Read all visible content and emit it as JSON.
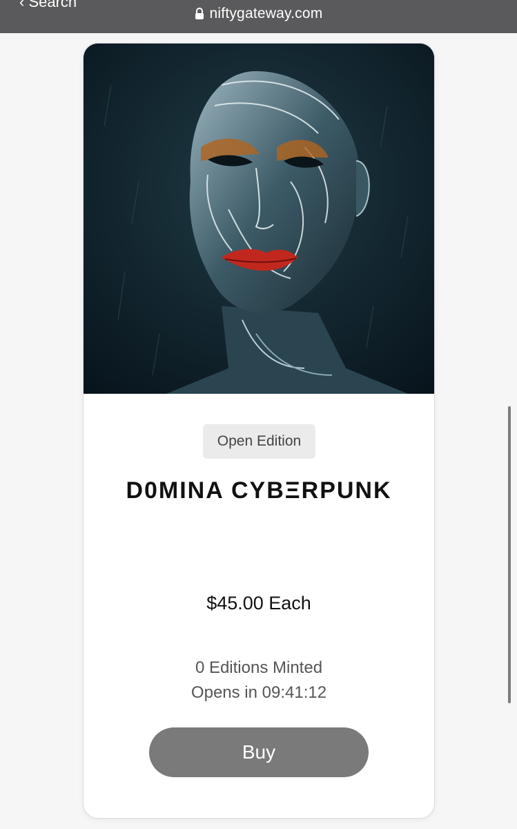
{
  "browser": {
    "back_label": "‹ Search",
    "url": "niftygateway.com",
    "lock_icon": "lock-icon"
  },
  "card": {
    "badge": "Open Edition",
    "title": "D0MINA CYBΞRPUNK",
    "price": "$45.00 Each",
    "editions_minted": "0 Editions Minted",
    "opens_in": "Opens in 09:41:12",
    "buy_label": "Buy"
  },
  "colors": {
    "topbar": "#5a5a5c",
    "buy_button": "#7a7a7a",
    "badge_bg": "#ebebeb",
    "lip_red": "#c0281e",
    "art_bg": "#0c1a20"
  }
}
